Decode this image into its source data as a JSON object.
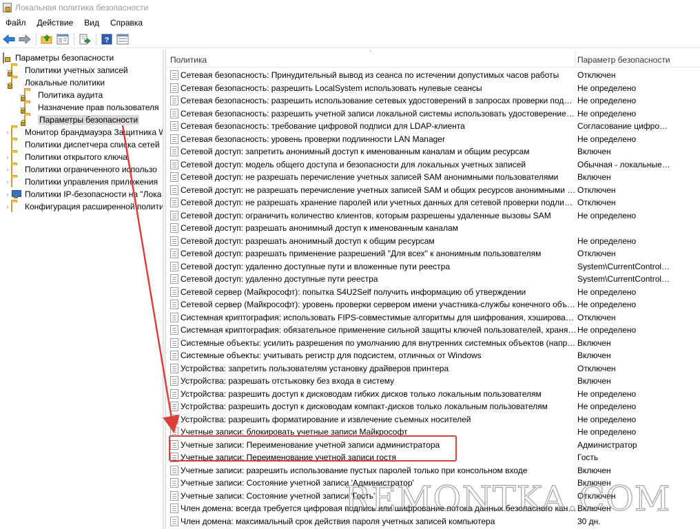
{
  "window": {
    "title": "Локальная политика безопасности"
  },
  "menu": [
    "Файл",
    "Действие",
    "Вид",
    "Справка"
  ],
  "toolbar": {
    "buttons": [
      "back-icon",
      "forward-icon",
      "up-folder-icon",
      "show-tree-icon",
      "export-list-icon",
      "help-icon",
      "properties-icon"
    ]
  },
  "tree": {
    "root": "Параметры безопасности",
    "items": [
      {
        "label": "Политики учетных записей",
        "level": 1,
        "icon": "folder-lock-icon",
        "expander": "collapsed"
      },
      {
        "label": "Локальные политики",
        "level": 1,
        "icon": "folder-lock-icon",
        "expander": "expanded"
      },
      {
        "label": "Политика аудита",
        "level": 2,
        "icon": "folder-lock-icon",
        "expander": "collapsed"
      },
      {
        "label": "Назначение прав пользователя",
        "level": 2,
        "icon": "folder-lock-icon",
        "expander": "collapsed"
      },
      {
        "label": "Параметры безопасности",
        "level": 2,
        "icon": "folder-lock-icon",
        "expander": "none",
        "selected": true
      },
      {
        "label": "Монитор брандмауэра Защитника W",
        "level": 1,
        "icon": "folder-icon",
        "expander": "collapsed"
      },
      {
        "label": "Политики диспетчера списка сетей",
        "level": 1,
        "icon": "folder-icon",
        "expander": "none"
      },
      {
        "label": "Политики открытого ключа",
        "level": 1,
        "icon": "folder-icon",
        "expander": "collapsed"
      },
      {
        "label": "Политики ограниченного использо",
        "level": 1,
        "icon": "folder-icon",
        "expander": "collapsed"
      },
      {
        "label": "Политики управления приложения",
        "level": 1,
        "icon": "folder-icon",
        "expander": "collapsed"
      },
      {
        "label": "Политики IP-безопасности на \"Лока",
        "level": 1,
        "icon": "computer-icon",
        "expander": "collapsed"
      },
      {
        "label": "Конфигурация расширенной полити",
        "level": 1,
        "icon": "folder-icon",
        "expander": "collapsed"
      }
    ]
  },
  "list": {
    "columns": [
      "Политика",
      "Параметр безопасности"
    ],
    "rows": [
      {
        "policy": "Сетевая безопасность: Принудительный вывод из сеанса по истечении допустимых часов работы",
        "setting": "Отключен"
      },
      {
        "policy": "Сетевая безопасность: разрешить LocalSystem использовать нулевые сеансы",
        "setting": "Не определено"
      },
      {
        "policy": "Сетевая безопасность: разрешить использование сетевых удостоверений в запросах проверки подлинно...",
        "setting": "Не определено"
      },
      {
        "policy": "Сетевая безопасность: разрешить учетной записи локальной системы использовать удостоверение компь...",
        "setting": "Не определено"
      },
      {
        "policy": "Сетевая безопасность: требование цифровой подписи для LDAP-клиента",
        "setting": "Согласование цифрово..."
      },
      {
        "policy": "Сетевая безопасность: уровень проверки подлинности LAN Manager",
        "setting": "Не определено"
      },
      {
        "policy": "Сетевой доступ: запретить анонимный доступ к именованным каналам и общим ресурсам",
        "setting": "Включен"
      },
      {
        "policy": "Сетевой доступ: модель общего доступа и безопасности для локальных учетных записей",
        "setting": "Обычная - локальные п..."
      },
      {
        "policy": "Сетевой доступ: не разрешать перечисление учетных записей SAM анонимными пользователями",
        "setting": "Включен"
      },
      {
        "policy": "Сетевой доступ: не разрешать перечисление учетных записей SAM и общих ресурсов анонимными польз...",
        "setting": "Отключен"
      },
      {
        "policy": "Сетевой доступ: не разрешать хранение паролей или учетных данных для сетевой проверки подлинности",
        "setting": "Отключен"
      },
      {
        "policy": "Сетевой доступ: ограничить количество клиентов, которым разрешены удаленные вызовы SAM",
        "setting": "Не определено"
      },
      {
        "policy": "Сетевой доступ: разрешать анонимный доступ к именованным каналам",
        "setting": ""
      },
      {
        "policy": "Сетевой доступ: разрешать анонимный доступ к общим ресурсам",
        "setting": "Не определено"
      },
      {
        "policy": "Сетевой доступ: разрешать применение разрешений \"Для всех\" к анонимным пользователям",
        "setting": "Отключен"
      },
      {
        "policy": "Сетевой доступ: удаленно доступные пути и вложенные пути реестра",
        "setting": "System\\CurrentControlS..."
      },
      {
        "policy": "Сетевой доступ: удаленно доступные пути реестра",
        "setting": "System\\CurrentControlS..."
      },
      {
        "policy": "Сетевой сервер (Майкрософт): попытка S4U2Self получить информацию об утверждении",
        "setting": "Не определено"
      },
      {
        "policy": "Сетевой сервер (Майкрософт): уровень проверки сервером имени участника-службы конечного объекта",
        "setting": "Не определено"
      },
      {
        "policy": "Системная криптография: использовать FIPS-совместимые алгоритмы для шифрования, хэширования и ...",
        "setting": "Отключен"
      },
      {
        "policy": "Системная криптография: обязательное применение сильной защиты ключей пользователей, хранящихся...",
        "setting": "Не определено"
      },
      {
        "policy": "Системные объекты: усилить разрешения по умолчанию для внутренних системных объектов (например, ...",
        "setting": "Включен"
      },
      {
        "policy": "Системные объекты: учитывать регистр для подсистем, отличных от Windows",
        "setting": "Включен"
      },
      {
        "policy": "Устройства: запретить пользователям установку драйверов принтера",
        "setting": "Отключен"
      },
      {
        "policy": "Устройства: разрешать отстыковку без входа в систему",
        "setting": "Включен"
      },
      {
        "policy": "Устройства: разрешить доступ к дисководам гибких дисков только локальным пользователям",
        "setting": "Не определено"
      },
      {
        "policy": "Устройства: разрешить доступ к дисководам компакт-дисков только локальным пользователям",
        "setting": "Не определено"
      },
      {
        "policy": "Устройства: разрешить форматирование и извлечение съемных носителей",
        "setting": "Не определено"
      },
      {
        "policy": "Учетные записи: блокировать учетные записи Майкрософт",
        "setting": "Не определено"
      },
      {
        "policy": "Учетные записи: Переименование учетной записи администратора",
        "setting": "Администратор"
      },
      {
        "policy": "Учетные записи: Переименование учетной записи гостя",
        "setting": "Гость"
      },
      {
        "policy": "Учетные записи: разрешить использование пустых паролей только при консольном входе",
        "setting": "Включен"
      },
      {
        "policy": "Учетные записи: Состояние учетной записи 'Администратор'",
        "setting": "Включен"
      },
      {
        "policy": "Учетные записи: Состояние учетной записи 'Гость'",
        "setting": "Отключен"
      },
      {
        "policy": "Член домена: всегда требуется цифровая подпись или шифрование потока данных безопасного канала",
        "setting": "Включен"
      },
      {
        "policy": "Член домена: максимальный срок действия пароля учетных записей компьютера",
        "setting": "30 дн."
      }
    ]
  },
  "annotation": {
    "color": "#d9413a"
  },
  "watermark": "REMONTKA.COM"
}
